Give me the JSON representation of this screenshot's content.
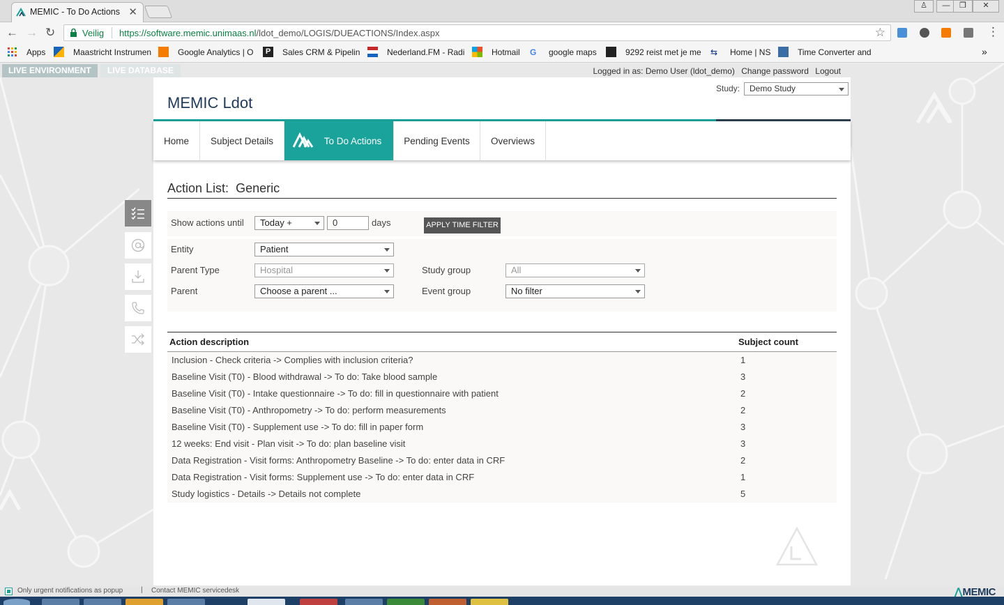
{
  "browser": {
    "tab_title": "MEMIC - To Do Actions",
    "tab_close": "✕",
    "secure_label": "Veilig",
    "url_host": "https://software.memic.unimaas.nl",
    "url_path": "/ldot_demo/LOGIS/DUEACTIONS/Index.aspx",
    "window_buttons": [
      "♙",
      "—",
      "❐",
      "✕"
    ],
    "bookmarks": [
      "Apps",
      "Maastricht Instrumen",
      "Google Analytics | O",
      "Sales CRM & Pipelin",
      "Nederland.FM - Radi",
      "Hotmail",
      "google maps",
      "9292 reist met je me",
      "Home | NS",
      "Time Converter and"
    ],
    "more": "»"
  },
  "env": {
    "live_environment": "LIVE ENVIRONMENT",
    "live_database": "LIVE DATABASE",
    "logged_in": "Logged in as: Demo User (ldot_demo)",
    "change_password": "Change password",
    "logout": "Logout"
  },
  "header": {
    "title": "MEMIC Ldot",
    "study_label": "Study:",
    "study_value": "Demo Study"
  },
  "nav": {
    "items": [
      "Home",
      "Subject Details",
      "To Do Actions",
      "Pending Events",
      "Overviews"
    ],
    "active": "To Do Actions"
  },
  "side_icons": [
    "checklist-icon",
    "at-icon",
    "download-icon",
    "phone-icon",
    "shuffle-icon"
  ],
  "main": {
    "section_prefix": "Action List:",
    "section_name": "Generic"
  },
  "filters": {
    "show_actions_label": "Show actions until",
    "until_value": "Today +",
    "days_value": "0",
    "days_label": "days",
    "apply_label": "APPLY TIME FILTER",
    "entity_label": "Entity",
    "entity_value": "Patient",
    "parent_type_label": "Parent Type",
    "parent_type_value": "Hospital",
    "parent_label": "Parent",
    "parent_value": "Choose a parent ...",
    "study_group_label": "Study group",
    "study_group_value": "All",
    "event_group_label": "Event group",
    "event_group_value": "No filter"
  },
  "table": {
    "col_description": "Action description",
    "col_count": "Subject count",
    "rows": [
      {
        "description": "Inclusion - Check criteria -> Complies with inclusion criteria?",
        "count": "1"
      },
      {
        "description": "Baseline Visit (T0) - Blood withdrawal -> To do: Take blood sample",
        "count": "3"
      },
      {
        "description": "Baseline Visit (T0) - Intake questionnaire -> To do: fill in questionnaire with patient",
        "count": "2"
      },
      {
        "description": "Baseline Visit (T0) - Anthropometry -> To do: perform measurements",
        "count": "2"
      },
      {
        "description": "Baseline Visit (T0) - Supplement use -> To do: fill in paper form",
        "count": "3"
      },
      {
        "description": "12 weeks: End visit - Plan visit -> To do: plan baseline visit",
        "count": "3"
      },
      {
        "description": "Data Registration - Visit forms: Anthropometry Baseline -> To do: enter data in CRF",
        "count": "2"
      },
      {
        "description": "Data Registration - Visit forms: Supplement use -> To do: enter data in CRF",
        "count": "1"
      },
      {
        "description": "Study logistics - Details -> Details not complete",
        "count": "5"
      }
    ]
  },
  "status": {
    "popup_label": "Only urgent notifications as popup",
    "separator": "|",
    "servicedesk": "Contact MEMIC servicedesk",
    "logo_main": "MEMIC"
  },
  "colors": {
    "accent": "#1aa39a",
    "title": "#1f3b5c",
    "button": "#555555"
  }
}
